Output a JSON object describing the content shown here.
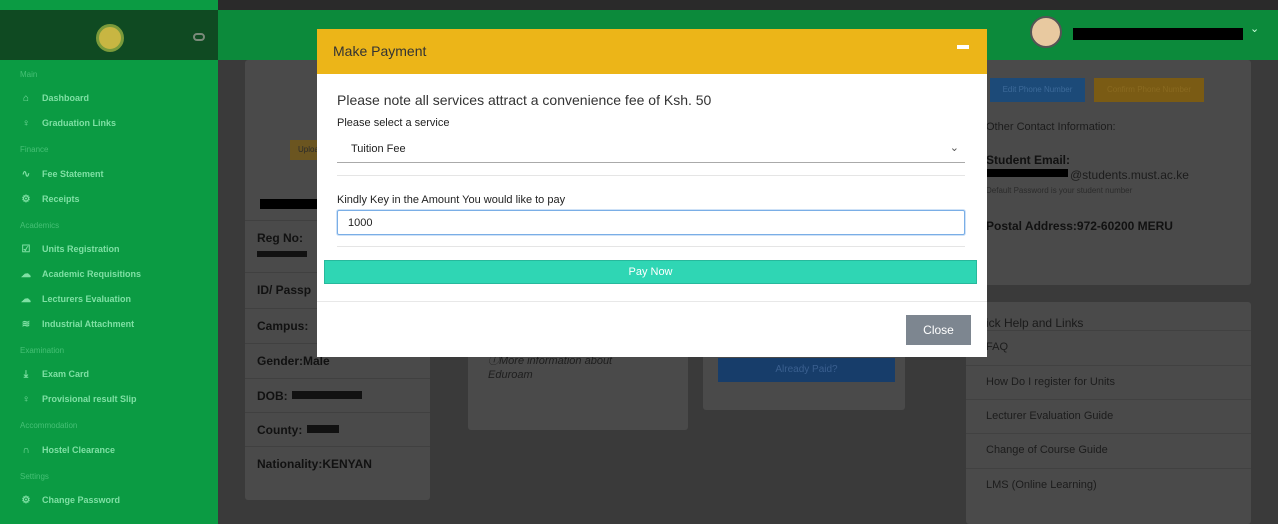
{
  "sidebar": {
    "sections": [
      {
        "label": "Main",
        "items": [
          {
            "label": "Dashboard",
            "icon": "home-icon"
          },
          {
            "label": "Graduation Links",
            "icon": "bulb-icon"
          }
        ]
      },
      {
        "label": "Finance",
        "items": [
          {
            "label": "Fee Statement",
            "icon": "pulse-icon"
          },
          {
            "label": "Receipts",
            "icon": "gear-icon"
          }
        ]
      },
      {
        "label": "Academics",
        "items": [
          {
            "label": "Units Registration",
            "icon": "checklist-icon"
          },
          {
            "label": "Academic Requisitions",
            "icon": "cloud-icon"
          },
          {
            "label": "Lecturers Evaluation",
            "icon": "cloud-icon"
          },
          {
            "label": "Industrial Attachment",
            "icon": "layers-icon"
          }
        ]
      },
      {
        "label": "Examination",
        "items": [
          {
            "label": "Exam Card",
            "icon": "download-icon"
          },
          {
            "label": "Provisional result Slip",
            "icon": "bulb-icon"
          }
        ]
      },
      {
        "label": "Accommodation",
        "items": [
          {
            "label": "Hostel Clearance",
            "icon": "headphones-icon"
          }
        ]
      },
      {
        "label": "Settings",
        "items": [
          {
            "label": "Change Password",
            "icon": "gear-icon"
          }
        ]
      }
    ]
  },
  "profile": {
    "upload_label": "Upload",
    "reg_no_label": "Reg No:",
    "id_label": "ID/ Passp",
    "campus_label": "Campus:",
    "gender_label": "Gender:Male",
    "dob_label": "DOB:",
    "county_label": "County:",
    "nationality_label": "Nationality:KENYAN"
  },
  "eduroam": {
    "info": "ⓘMore information about Eduroam"
  },
  "payment_card": {
    "already_paid": "Already Paid?"
  },
  "contact": {
    "edit_phone": "Edit Phone Number",
    "confirm_phone": "Confirm Phone Number",
    "other_contact": "Other Contact Information:",
    "student_email_label": "Student Email:",
    "email_domain": "@students.must.ac.ke",
    "default_password_note": "Default Password is your student number",
    "postal_address": "Postal Address:972-60200 MERU"
  },
  "help": {
    "title": "ick Help and Links",
    "links": [
      "FAQ",
      "How Do I register for Units",
      "Lecturer Evaluation Guide",
      "Change of Course Guide",
      "LMS (Online Learning)"
    ]
  },
  "modal": {
    "title": "Make Payment",
    "fee_note": "Please note all services attract a convenience fee of Ksh. 50",
    "service_label": "Please select a service",
    "service_value": "Tuition Fee",
    "amount_label": "Kindly Key in the Amount You would like to pay",
    "amount_value": "1000",
    "pay_button": "Pay Now",
    "close_button": "Close"
  },
  "colors": {
    "modal_header": "#ecb518",
    "pay_button": "#2fd6b4",
    "sidebar": "#0b9b43",
    "close_button": "#7d8690"
  }
}
